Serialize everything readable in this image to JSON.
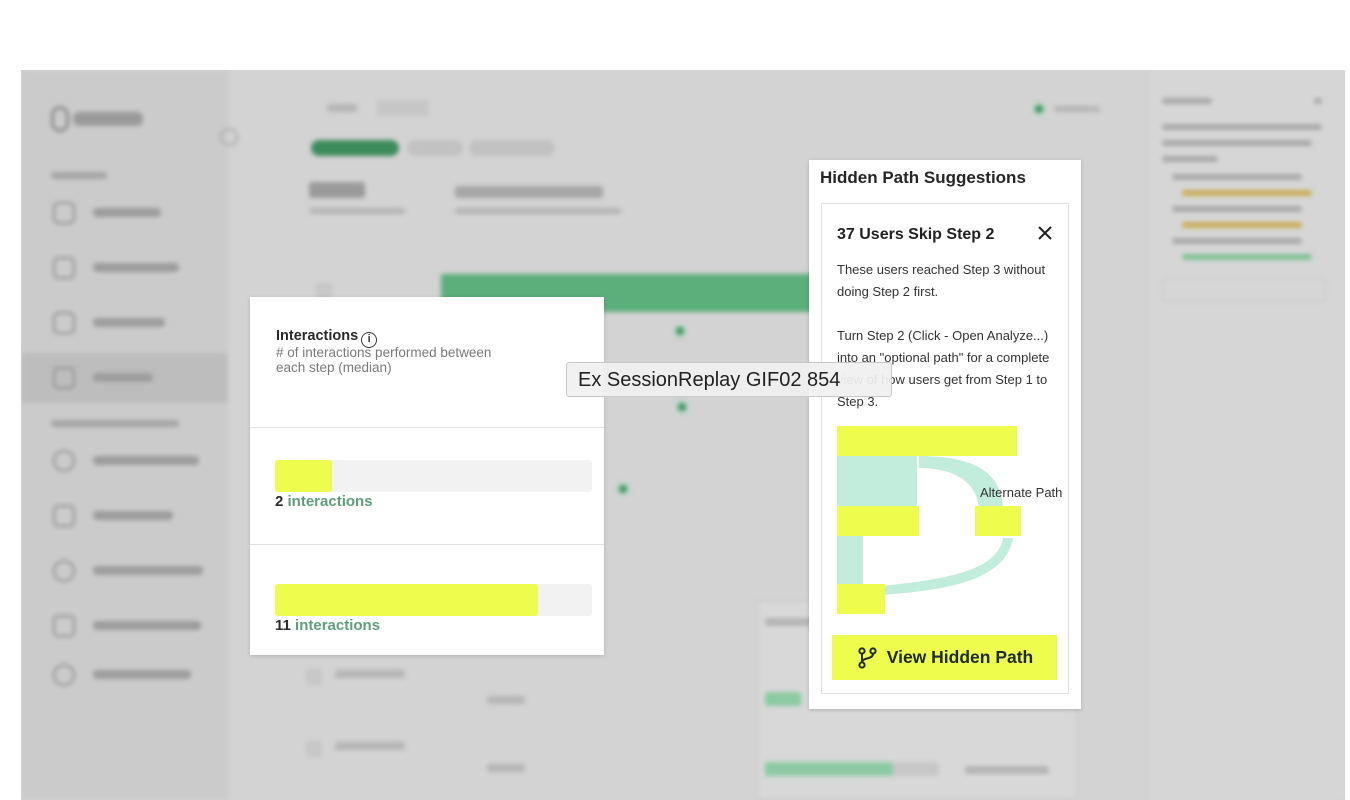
{
  "interactions": {
    "title": "Interactions",
    "info_glyph": "i",
    "description": "# of interactions performed between each step (median)",
    "rows": [
      {
        "count": "2",
        "unit": "interactions",
        "fill_percent": 18
      },
      {
        "count": "11",
        "unit": "interactions",
        "fill_percent": 83
      }
    ]
  },
  "hidden_path": {
    "title": "Hidden Path Suggestions",
    "card_title": "37 Users Skip Step 2",
    "paragraph1": "These users reached Step 3 without doing Step 2 first.",
    "paragraph2": "Turn Step 2 (Click - Open Analyze...) into an \"optional path\" for a complete view of how users get from Step 1 to Step 3.",
    "alternate_label": "Alternate Path",
    "button_label": "View Hidden Path",
    "button_icon": "branch-icon",
    "close_icon": "close-icon"
  },
  "overlay_label": "Ex SessionReplay GIF02 854",
  "colors": {
    "highlight_yellow": "#eefc4e",
    "link_green": "#5e9e7c",
    "flow_mint": "#c2ecdc",
    "background_gray": "#d3d3d3",
    "blurred_green": "#5cae7b"
  }
}
